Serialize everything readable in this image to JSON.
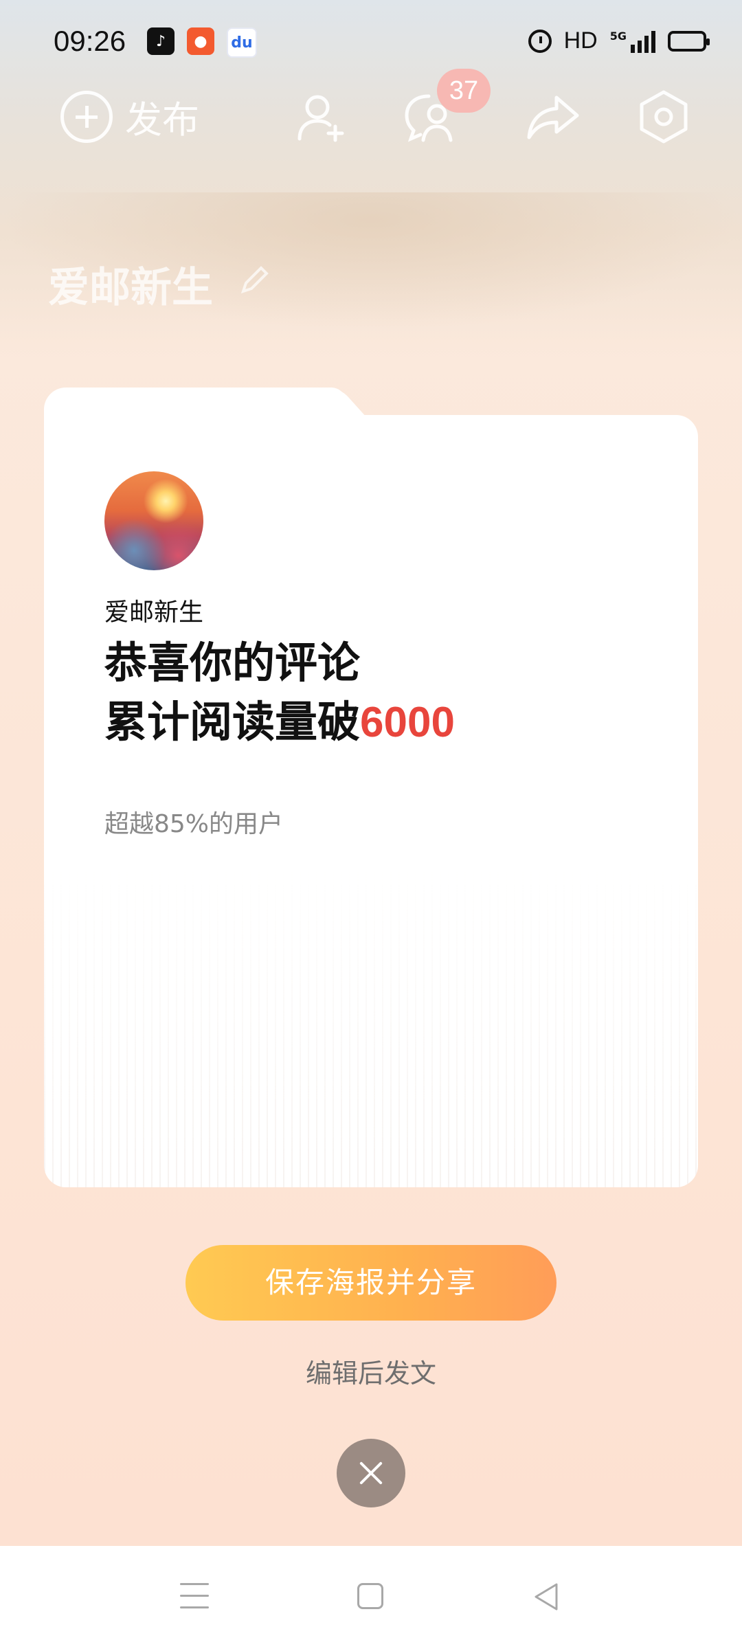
{
  "status_bar": {
    "time": "09:26",
    "network": "HD",
    "network_gen": "5G",
    "app_icons": [
      "tiktok-icon",
      "kuaishou-icon",
      "baidu-icon"
    ]
  },
  "toolbar": {
    "publish_label": "发布",
    "notification_count": "37",
    "icons": [
      "plus-circle-icon",
      "add-friend-icon",
      "messages-icon",
      "share-icon",
      "settings-icon"
    ]
  },
  "profile": {
    "name": "爱邮新生"
  },
  "poster": {
    "username": "爱邮新生",
    "headline_line1": "恭喜你的评论",
    "headline_line2_prefix": "累计阅读量破",
    "headline_number": "6000",
    "subtext": "超越85%的用户"
  },
  "actions": {
    "share_button": "保存海报并分享",
    "edit_link": "编辑后发文"
  },
  "colors": {
    "accent_red": "#e8453c",
    "button_start": "#ffca52",
    "button_end": "#ff9d58",
    "close_button": "#9b8b83"
  }
}
